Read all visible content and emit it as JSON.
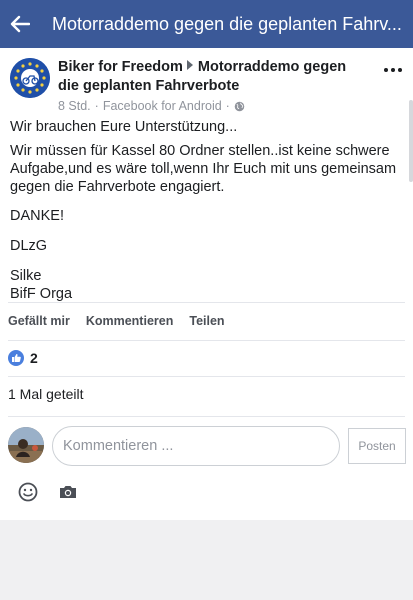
{
  "topbar": {
    "title": "Motorraddemo gegen die geplanten Fahrv..."
  },
  "post": {
    "page_name": "Biker for Freedom",
    "event_title": "Motorraddemo gegen die geplanten Fahrverbote",
    "time": "8 Std.",
    "separator": "·",
    "source": "Facebook for Android",
    "paragraphs": [
      "Wir brauchen Eure Unterstützung...",
      "Wir müssen für Kassel 80 Ordner stellen..ist keine schwere Aufgabe,und es wäre toll,wenn Ihr Euch mit uns gemeinsam gegen die Fahrverbote engagiert.",
      "DANKE!",
      "DLzG",
      "Silke",
      "BifF Orga"
    ]
  },
  "actions": {
    "like": "Gefällt mir",
    "comment": "Kommentieren",
    "share": "Teilen"
  },
  "reactions": {
    "count": "2"
  },
  "shares": {
    "text": "1 Mal geteilt"
  },
  "comment": {
    "placeholder": "Kommentieren ...",
    "post_label": "Posten"
  },
  "colors": {
    "brand": "#3b5998",
    "like": "#4a7fde"
  },
  "icons": [
    "back-arrow-icon",
    "globe-icon",
    "more-options-icon",
    "thumbs-up-icon",
    "emoji-icon",
    "camera-icon"
  ]
}
